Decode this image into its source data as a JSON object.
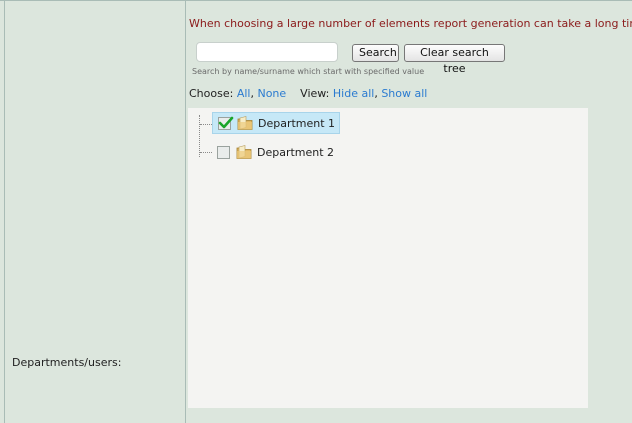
{
  "form": {
    "field_label": "Departments/users:",
    "warning": "When choosing a large number of elements report generation can take a long time.",
    "search": {
      "value": "",
      "placeholder": "",
      "button_label": "Search",
      "clear_label": "Clear search tree",
      "hint": "Search by name/surname which start with specified value"
    },
    "choose": {
      "label": "Choose:",
      "all": "All",
      "none": "None",
      "view_label": "View:",
      "hide_all": "Hide all",
      "show_all": "Show all",
      "separator": ","
    }
  },
  "tree": {
    "nodes": [
      {
        "label": "Department 1",
        "checked": true,
        "selected": true,
        "icon": "folder-icon"
      },
      {
        "label": "Department 2",
        "checked": false,
        "selected": false,
        "icon": "folder-icon"
      }
    ]
  },
  "colors": {
    "background": "#dce6dd",
    "warning_text": "#8b1a1a",
    "link": "#2b7bd0",
    "selected_node": "#c6e8f7",
    "checkmark": "#1aa52a"
  }
}
